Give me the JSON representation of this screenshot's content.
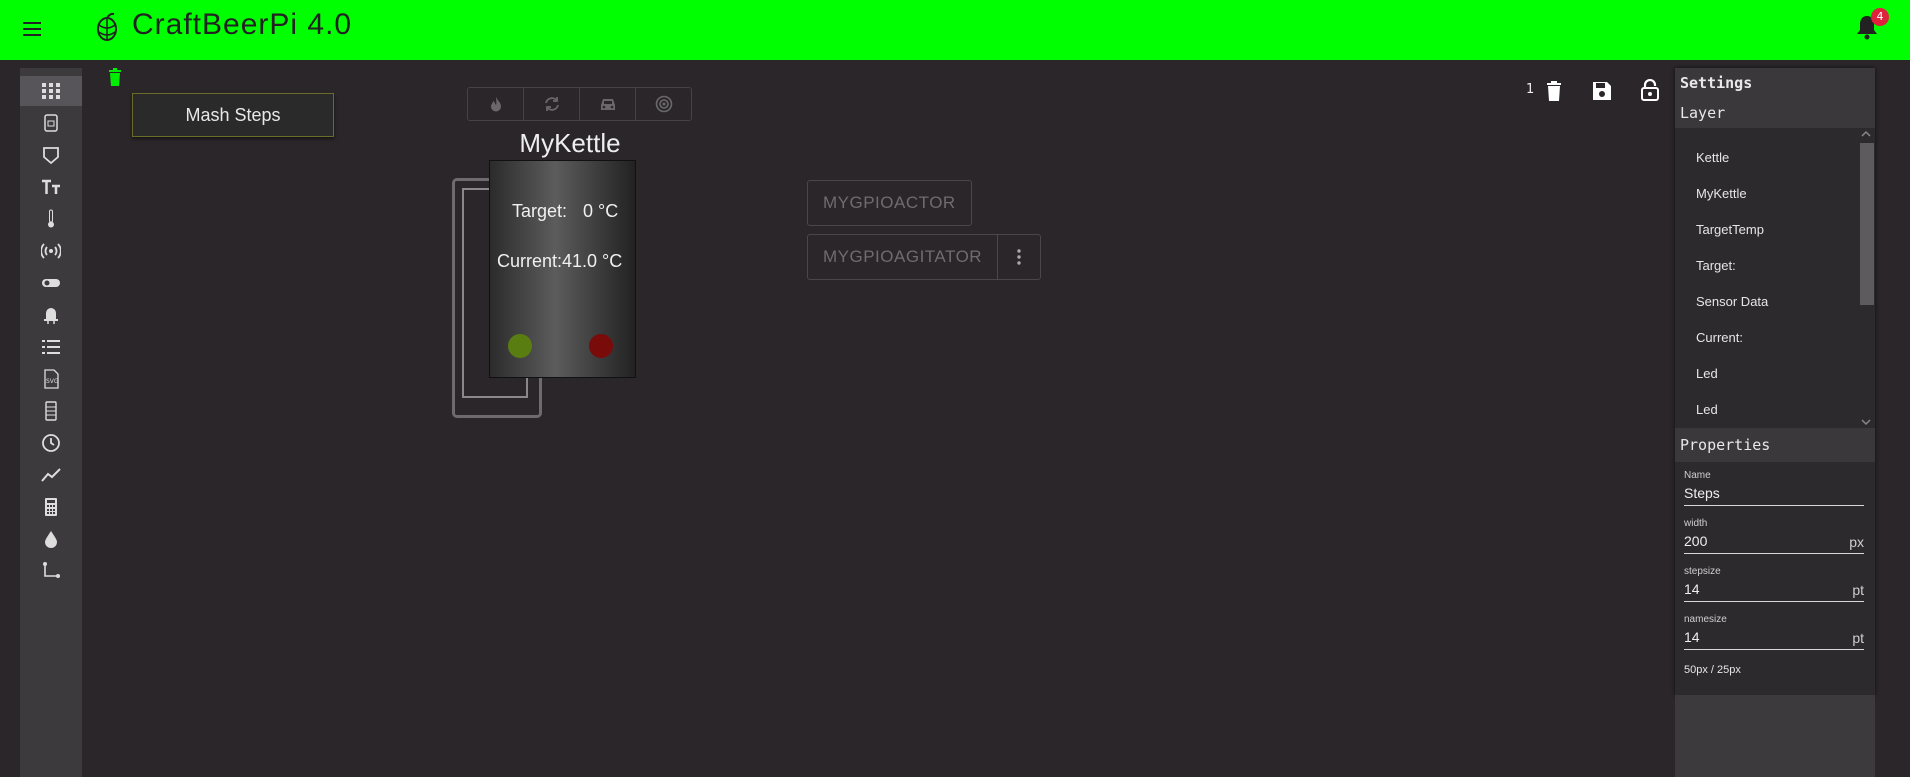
{
  "app": {
    "title": "CraftBeerPi 4.0",
    "notification_count": "4"
  },
  "colors": {
    "appbar": "#00ff00",
    "background": "#2a2629",
    "badge": "#e0213e",
    "led_green": "#5a7d12",
    "led_red": "#7a0b0b"
  },
  "sidebar": {
    "icons": [
      "dashboard-grid-icon",
      "kettle-icon",
      "tag-icon",
      "text-size-icon",
      "thermometer-icon",
      "broadcast-icon",
      "toggle-icon",
      "led-icon",
      "list-icon",
      "svg-file-icon",
      "cylinder-icon",
      "clock-icon",
      "chart-line-icon",
      "calculator-icon",
      "water-drop-icon",
      "connector-icon"
    ]
  },
  "canvas": {
    "mash_steps_label": "Mash Steps",
    "kettle": {
      "name": "MyKettle",
      "target_label": "Target:",
      "target_value": "0 °C",
      "current_label": "Current:",
      "current_value": "41.0 °C"
    },
    "actors": [
      {
        "label": "MYGPIOACTOR"
      },
      {
        "label": "MYGPIOAGITATOR"
      }
    ],
    "layer_count": "1"
  },
  "panel": {
    "title": "Settings",
    "layer_heading": "Layer",
    "layers": [
      "Kettle",
      "MyKettle",
      "TargetTemp",
      "Target:",
      "Sensor Data",
      "Current:",
      "Led",
      "Led"
    ],
    "properties_heading": "Properties",
    "fields": [
      {
        "label": "Name",
        "value": "Steps",
        "unit": ""
      },
      {
        "label": "width",
        "value": "200",
        "unit": "px"
      },
      {
        "label": "stepsize",
        "value": "14",
        "unit": "pt"
      },
      {
        "label": "namesize",
        "value": "14",
        "unit": "pt"
      }
    ],
    "footnote": "50px / 25px"
  }
}
